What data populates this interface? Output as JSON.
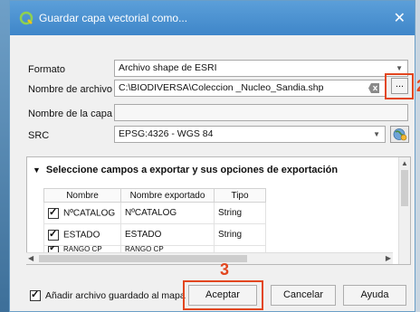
{
  "dialog": {
    "title": "Guardar capa vectorial como...",
    "close_glyph": "✕"
  },
  "form": {
    "format_label": "Formato",
    "format_value": "Archivo shape de ESRI",
    "filename_label": "Nombre de archivo",
    "filename_value": "C:\\BIODIVERSA\\Coleccion _Nucleo_Sandia.shp",
    "browse_label": "...",
    "layername_label": "Nombre de la capa",
    "layername_value": "",
    "src_label": "SRC",
    "src_value": "EPSG:4326 - WGS 84"
  },
  "fields_group": {
    "title": "Seleccione campos a exportar y sus opciones de exportación",
    "columns": [
      "Nombre",
      "Nombre exportado",
      "Tipo"
    ],
    "rows": [
      {
        "name": "NºCATALOG",
        "export": "NºCATALOG",
        "type": "String",
        "checked": true
      },
      {
        "name": "ESTADO",
        "export": "ESTADO",
        "type": "String",
        "checked": true
      },
      {
        "name": "RANGO CP",
        "export": "RANGO CP",
        "type": "",
        "checked": true
      }
    ]
  },
  "footer": {
    "add_to_map_label": "Añadir archivo guardado al mapa",
    "accept_label": "Aceptar",
    "cancel_label": "Cancelar",
    "help_label": "Ayuda"
  },
  "annotations": {
    "step_browse": "2",
    "step_accept": "3"
  },
  "colors": {
    "titlebar": "#4a90d2",
    "highlight": "#e2461f"
  },
  "icons": [
    "qgis-logo-icon",
    "close-icon",
    "clear-field-icon",
    "crs-globe-icon",
    "collapse-triangle-icon",
    "checkbox-icon"
  ]
}
